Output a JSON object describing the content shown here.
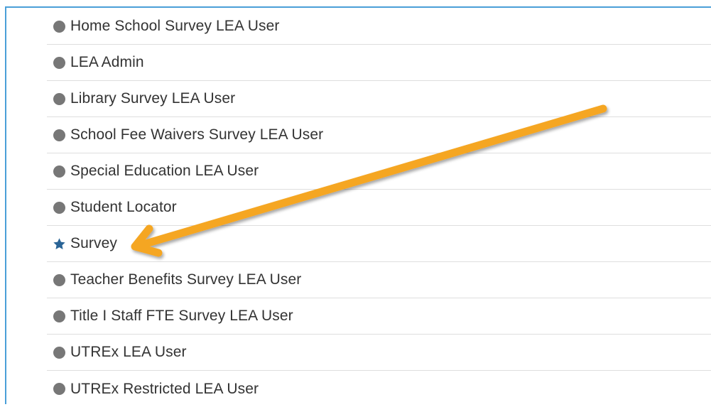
{
  "roles": [
    {
      "label": "Home School Survey LEA User",
      "icon": "circle-icon",
      "is_default": false
    },
    {
      "label": "LEA Admin",
      "icon": "circle-icon",
      "is_default": false
    },
    {
      "label": "Library Survey LEA User",
      "icon": "circle-icon",
      "is_default": false
    },
    {
      "label": "School Fee Waivers Survey LEA User",
      "icon": "circle-icon",
      "is_default": false
    },
    {
      "label": "Special Education LEA User",
      "icon": "circle-icon",
      "is_default": false
    },
    {
      "label": "Student Locator",
      "icon": "circle-icon",
      "is_default": false
    },
    {
      "label": "Survey",
      "icon": "star-icon",
      "is_default": true
    },
    {
      "label": "Teacher Benefits Survey LEA User",
      "icon": "circle-icon",
      "is_default": false
    },
    {
      "label": "Title I Staff FTE Survey LEA User",
      "icon": "circle-icon",
      "is_default": false
    },
    {
      "label": "UTREx LEA User",
      "icon": "circle-icon",
      "is_default": false
    },
    {
      "label": "UTREx Restricted LEA User",
      "icon": "circle-icon",
      "is_default": false
    }
  ],
  "colors": {
    "frame_border": "#4a9fd8",
    "dot": "#777777",
    "star": "#2a6496",
    "text": "#333333",
    "divider": "#dedede",
    "annotation_arrow": "#f5a623"
  },
  "annotation": {
    "icon": "arrow-icon",
    "points_to": "Survey"
  }
}
